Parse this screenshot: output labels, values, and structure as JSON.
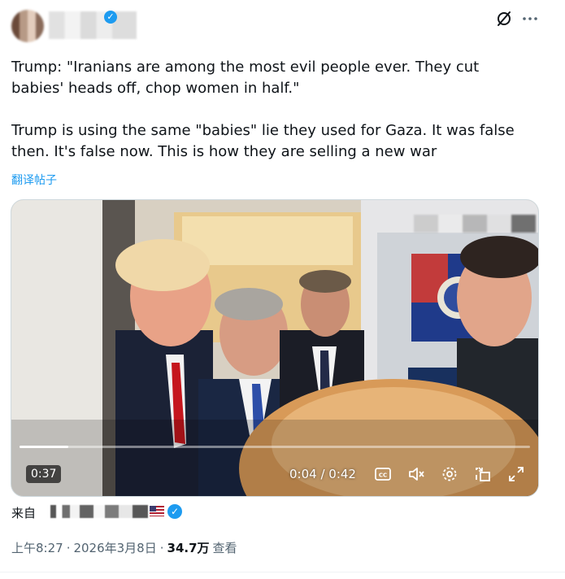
{
  "post": {
    "author_name": "",
    "text": "Trump: \"Iranians are among the most evil people ever. They cut babies' heads off, chop women in half.\"\n\nTrump is using the same \"babies\" lie they used for Gaza. It was false then. It's false now. This is how they are selling a new war",
    "translate_label": "翻译帖子"
  },
  "video": {
    "duration_badge": "0:37",
    "current_time": "0:04",
    "total_time": "0:42",
    "time_readout": "0:04 / 0:42",
    "progress_fraction": 0.095
  },
  "source": {
    "prefix": "来自"
  },
  "meta": {
    "time": "上午8:27",
    "separator": "·",
    "date": "2026年3月8日",
    "separator2": "·",
    "views": "34.7万",
    "views_label": "查看"
  },
  "colors": {
    "accent": "#1d9bf0",
    "text": "#0f1419",
    "muted": "#536471"
  },
  "icons": [
    "grok-icon",
    "more-icon",
    "captions-icon",
    "volume-muted-icon",
    "settings-icon",
    "pip-icon",
    "fullscreen-icon",
    "verified-icon"
  ]
}
